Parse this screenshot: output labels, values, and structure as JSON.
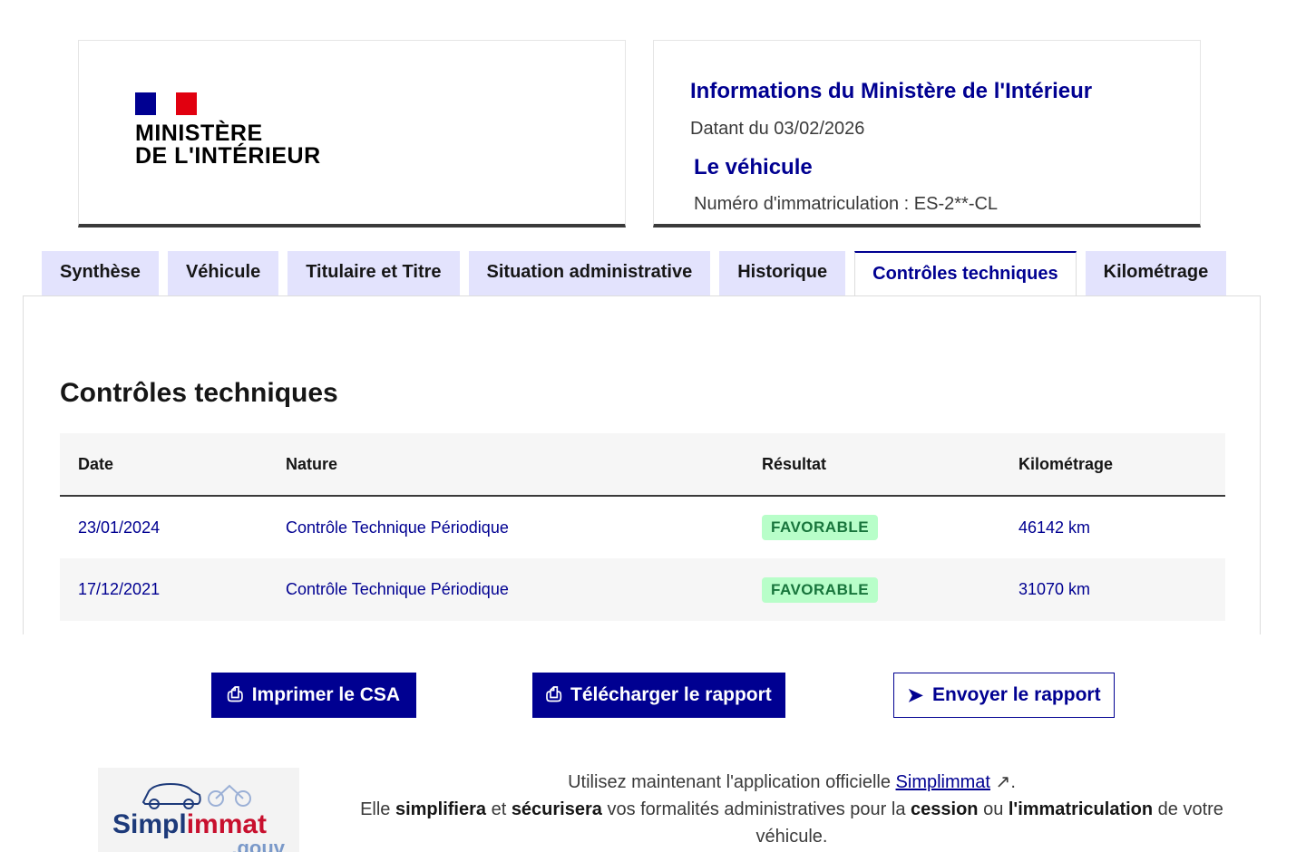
{
  "header": {
    "logo_lines": [
      "MINISTÈRE",
      "DE L'INTÉRIEUR"
    ],
    "info_title": "Informations du Ministère de l'Intérieur",
    "date": "Datant du 03/02/2026",
    "vehicle_title": "Le véhicule",
    "plate": "Numéro d'immatriculation : ES-2**-CL"
  },
  "tabs": [
    "Synthèse",
    "Véhicule",
    "Titulaire et Titre",
    "Situation administrative",
    "Historique",
    "Contrôles techniques",
    "Kilométrage"
  ],
  "section": {
    "title": "Contrôles techniques",
    "columns": [
      "Date",
      "Nature",
      "Résultat",
      "Kilométrage"
    ],
    "rows": [
      [
        "23/01/2024",
        "Contrôle Technique Périodique",
        "FAVORABLE",
        "46142 km"
      ],
      [
        "17/12/2021",
        "Contrôle Technique Périodique",
        "FAVORABLE",
        "31070 km"
      ]
    ]
  },
  "buttons": {
    "print": "Imprimer le CSA",
    "download": "Télécharger le rapport",
    "send": "Envoyer le rapport"
  },
  "footer": {
    "logo_a": "Simpl",
    "logo_b": "immat",
    "logo_c": ".gouv",
    "line1": "Utilisez maintenant l'application officielle ",
    "link": "Simplimmat",
    "t1": "Elle ",
    "b1": "simplifiera",
    "t2": " et ",
    "b2": "sécurisera",
    "t3": " vos formalités administratives pour la ",
    "b3": "cession",
    "t4": " ou ",
    "b4": "l'immatriculation",
    "t5": " de votre véhicule."
  },
  "colors": {
    "primary": "#000091",
    "tab_bg": "#e3e3fd",
    "badge_bg": "#b8fec9",
    "badge_text": "#18753c"
  }
}
